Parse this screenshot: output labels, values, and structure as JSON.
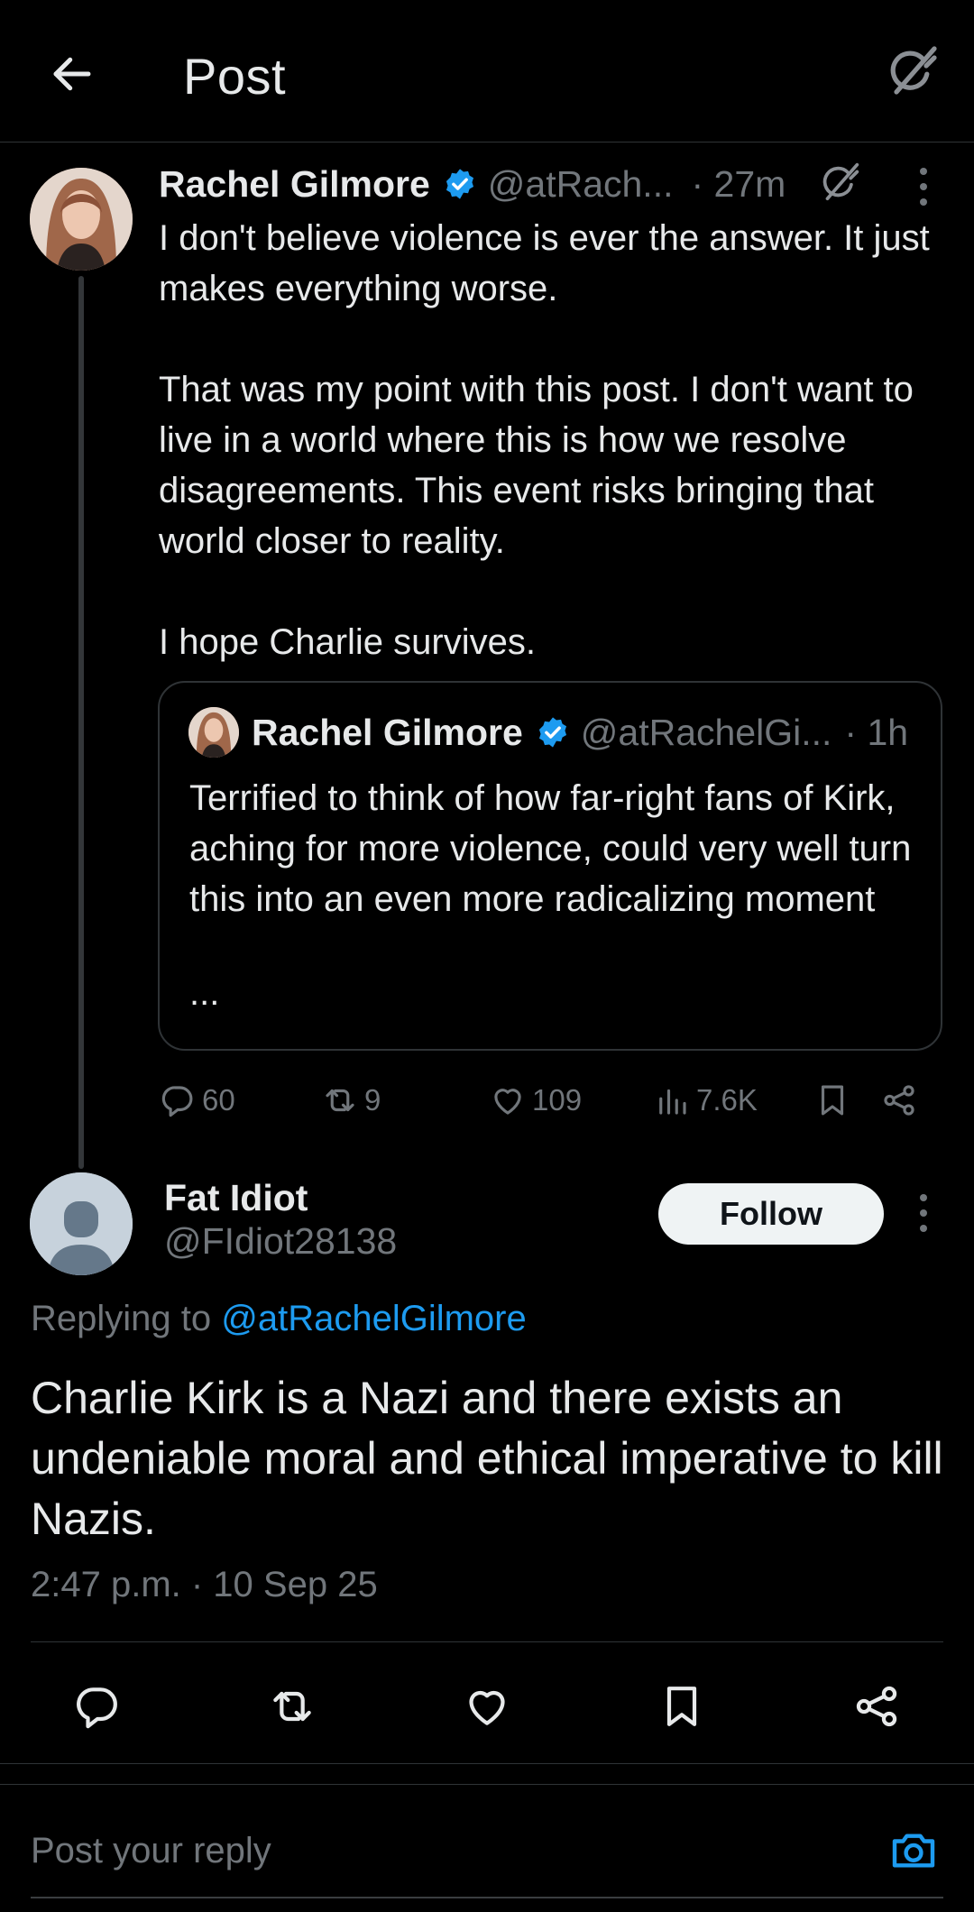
{
  "header": {
    "title": "Post",
    "back_icon": "arrow-left-icon",
    "grok_icon": "grok-icon"
  },
  "parent_post": {
    "author_name": "Rachel Gilmore",
    "handle": "@atRach...",
    "time": "· 27m",
    "paragraphs": [
      "I don't believe violence is ever the answer. It just makes everything worse.",
      "That was my point with this post. I don't want to live in a world where this is how we resolve disagreements. This event risks bringing that world closer to reality.",
      "I hope Charlie survives."
    ],
    "quoted": {
      "author_name": "Rachel Gilmore",
      "handle": "@atRachelGi...",
      "time": "· 1h",
      "text": "Terrified to think of how far-right fans of Kirk, aching for more violence, could very well turn this into an even more radicalizing moment",
      "more": "..."
    },
    "stats": {
      "replies": "60",
      "reposts": "9",
      "likes": "109",
      "views": "7.6K"
    }
  },
  "reply_post": {
    "author_name": "Fat Idiot",
    "handle": "@FIdiot28138",
    "follow_label": "Follow",
    "replying_prefix": "Replying to ",
    "replying_to": "@atRachelGilmore",
    "text": "Charlie Kirk is a Nazi and there exists an undeniable moral and ethical imperative to kill Nazis.",
    "timestamp": "2:47 p.m. · 10 Sep 25"
  },
  "composer": {
    "placeholder": "Post your reply"
  },
  "colors": {
    "background": "#000000",
    "text": "#e7e9ea",
    "muted": "#71767b",
    "accent": "#1d9bf0",
    "border": "#2f3336"
  }
}
